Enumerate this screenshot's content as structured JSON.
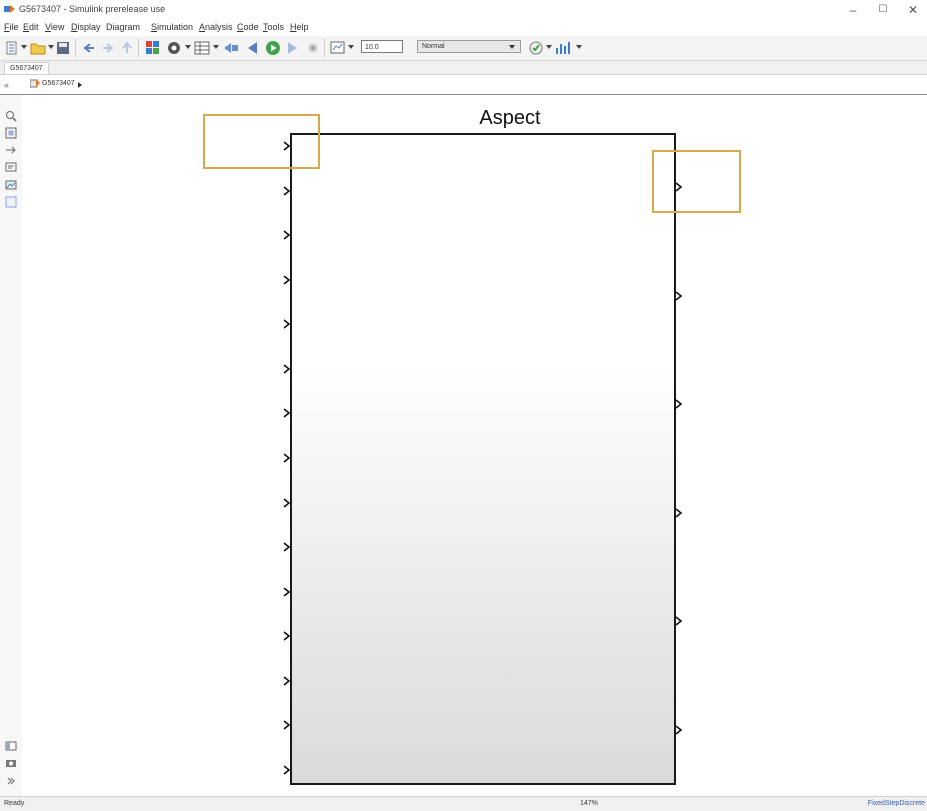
{
  "window": {
    "title": "G5673407 - Simulink prerelease use",
    "minimize_glyph": "–",
    "maximize_glyph": "☐",
    "close_glyph": "✕"
  },
  "menu": {
    "items": [
      {
        "ul": "F",
        "rest": "ile"
      },
      {
        "ul": "E",
        "rest": "dit"
      },
      {
        "ul": "V",
        "rest": "iew"
      },
      {
        "ul": "D",
        "rest": "isplay"
      },
      {
        "ul": "",
        "rest": "Diagram"
      },
      {
        "ul": "S",
        "rest": "imulation"
      },
      {
        "ul": "A",
        "rest": "nalysis"
      },
      {
        "ul": "C",
        "rest": "ode"
      },
      {
        "ul": "T",
        "rest": "ools"
      },
      {
        "ul": "H",
        "rest": "elp"
      }
    ]
  },
  "toolbar": {
    "stop_time": "10.0",
    "sim_mode": "Normal",
    "icons": [
      "new-model-icon",
      "open-icon",
      "save-icon",
      "back-icon",
      "forward-icon",
      "up-icon",
      "library-browser-icon",
      "model-settings-icon",
      "model-explorer-icon",
      "step-back-icon",
      "run-icon",
      "step-forward-icon",
      "stop-icon",
      "record-icon",
      "build-icon",
      "data-inspector-icon"
    ]
  },
  "tabs": {
    "model_tab": "G5673407"
  },
  "address": {
    "hide_glyph": "«",
    "path": "G5673407"
  },
  "palette": {
    "icons": [
      "zoom-icon",
      "fit-view-icon",
      "arrow-icon",
      "annotation-icon",
      "image-icon",
      "area-icon",
      "model-browser-icon",
      "screenshot-icon",
      "expand-icon"
    ]
  },
  "block": {
    "title": "Aspect",
    "input_port_count": 15,
    "output_port_count": 6
  },
  "colors": {
    "highlight": "#d8a94a",
    "block_border": "#1a1a1a",
    "solver_link": "#3b5bb5"
  },
  "status": {
    "ready": "Ready",
    "zoom": "147%",
    "solver": "FixedStepDiscrete"
  }
}
